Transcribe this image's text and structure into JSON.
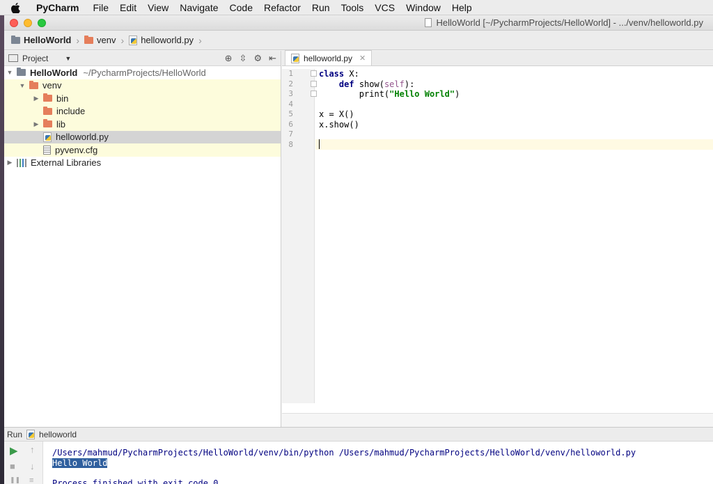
{
  "menubar": {
    "app": "PyCharm",
    "items": [
      "File",
      "Edit",
      "View",
      "Navigate",
      "Code",
      "Refactor",
      "Run",
      "Tools",
      "VCS",
      "Window",
      "Help"
    ]
  },
  "window": {
    "title": "HelloWorld [~/PycharmProjects/HelloWorld] - .../venv/helloworld.py"
  },
  "navbar": {
    "crumbs": [
      "HelloWorld",
      "venv",
      "helloworld.py"
    ]
  },
  "project_panel": {
    "label": "Project",
    "root": {
      "name": "HelloWorld",
      "path": "~/PycharmProjects/HelloWorld"
    },
    "items": [
      {
        "name": "venv"
      },
      {
        "name": "bin"
      },
      {
        "name": "include"
      },
      {
        "name": "lib"
      },
      {
        "name": "helloworld.py"
      },
      {
        "name": "pyvenv.cfg"
      },
      {
        "name": "External Libraries"
      }
    ]
  },
  "editor": {
    "tab": "helloworld.py",
    "line_numbers": [
      "1",
      "2",
      "3",
      "4",
      "5",
      "6",
      "7",
      "8"
    ],
    "code": {
      "l1_kw": "class",
      "l1_rest": " X:",
      "l2_indent": "    ",
      "l2_kw": "def",
      "l2_name": " show(",
      "l2_self": "self",
      "l2_end": "):",
      "l3_indent": "        ",
      "l3_call": "print(",
      "l3_str": "\"Hello World\"",
      "l3_end": ")",
      "l5": "x = X()",
      "l6": "x.show()"
    },
    "current_line": 8
  },
  "run_panel": {
    "label": "Run",
    "config": "helloworld",
    "output": {
      "command": "/Users/mahmud/PycharmProjects/HelloWorld/venv/bin/python /Users/mahmud/PycharmProjects/HelloWorld/venv/helloworld.py",
      "stdout": "Hello World",
      "finish": "Process finished with exit code 0"
    }
  },
  "colors": {
    "current_line": "#fffae3",
    "folder_orange": "#e57e5b",
    "selection": "#d4d4d4",
    "keyword": "#000080",
    "string": "#008000"
  },
  "icons": [
    "apple-icon",
    "folder-icon",
    "python-file-icon",
    "config-file-icon",
    "library-icon",
    "locate-icon",
    "collapse-icon",
    "gear-icon",
    "hide-icon",
    "run-icon",
    "stop-icon",
    "up-icon",
    "down-icon"
  ]
}
